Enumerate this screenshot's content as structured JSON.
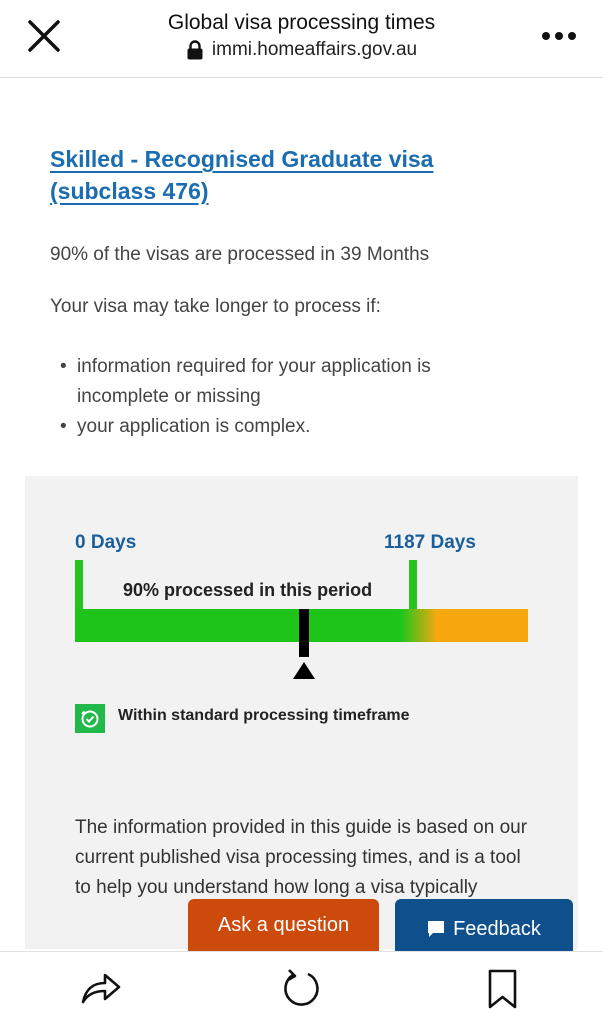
{
  "header": {
    "title": "Global visa processing times",
    "url": "immi.homeaffairs.gov.au",
    "icons": {
      "close": "close-icon",
      "lock": "lock-icon",
      "more": "more-options-icon"
    }
  },
  "main": {
    "visa_title": "Skilled - Recognised Graduate visa (subclass 476)",
    "processed_text": "90% of the visas are processed in 39 Months",
    "longer_intro": "Your visa may take longer to process if:",
    "reasons": [
      "information required for your application is incomplete or missing",
      "your application is complex."
    ]
  },
  "timeline": {
    "start_label": "0 Days",
    "end_label": "1187 Days",
    "period_label": "90% processed in this period",
    "status_text": "Within standard processing timeframe",
    "status_icon": "clock-check-icon",
    "colors": {
      "in_range": "#1fc41a",
      "beyond": "#f7a80f",
      "marker": "#000000",
      "label": "#1a5f9c"
    }
  },
  "info_text": "The information provided in this guide is based on our current published visa processing times, and is a tool to help you understand how long a visa typically",
  "floating": {
    "ask_label": "Ask a question",
    "feedback_label": "Feedback",
    "feedback_icon": "comment-icon",
    "colors": {
      "ask": "#cc4a0c",
      "feedback": "#0e4f8c"
    }
  },
  "bottom_nav": {
    "icons": [
      "share-icon",
      "reload-icon",
      "bookmark-icon"
    ]
  }
}
